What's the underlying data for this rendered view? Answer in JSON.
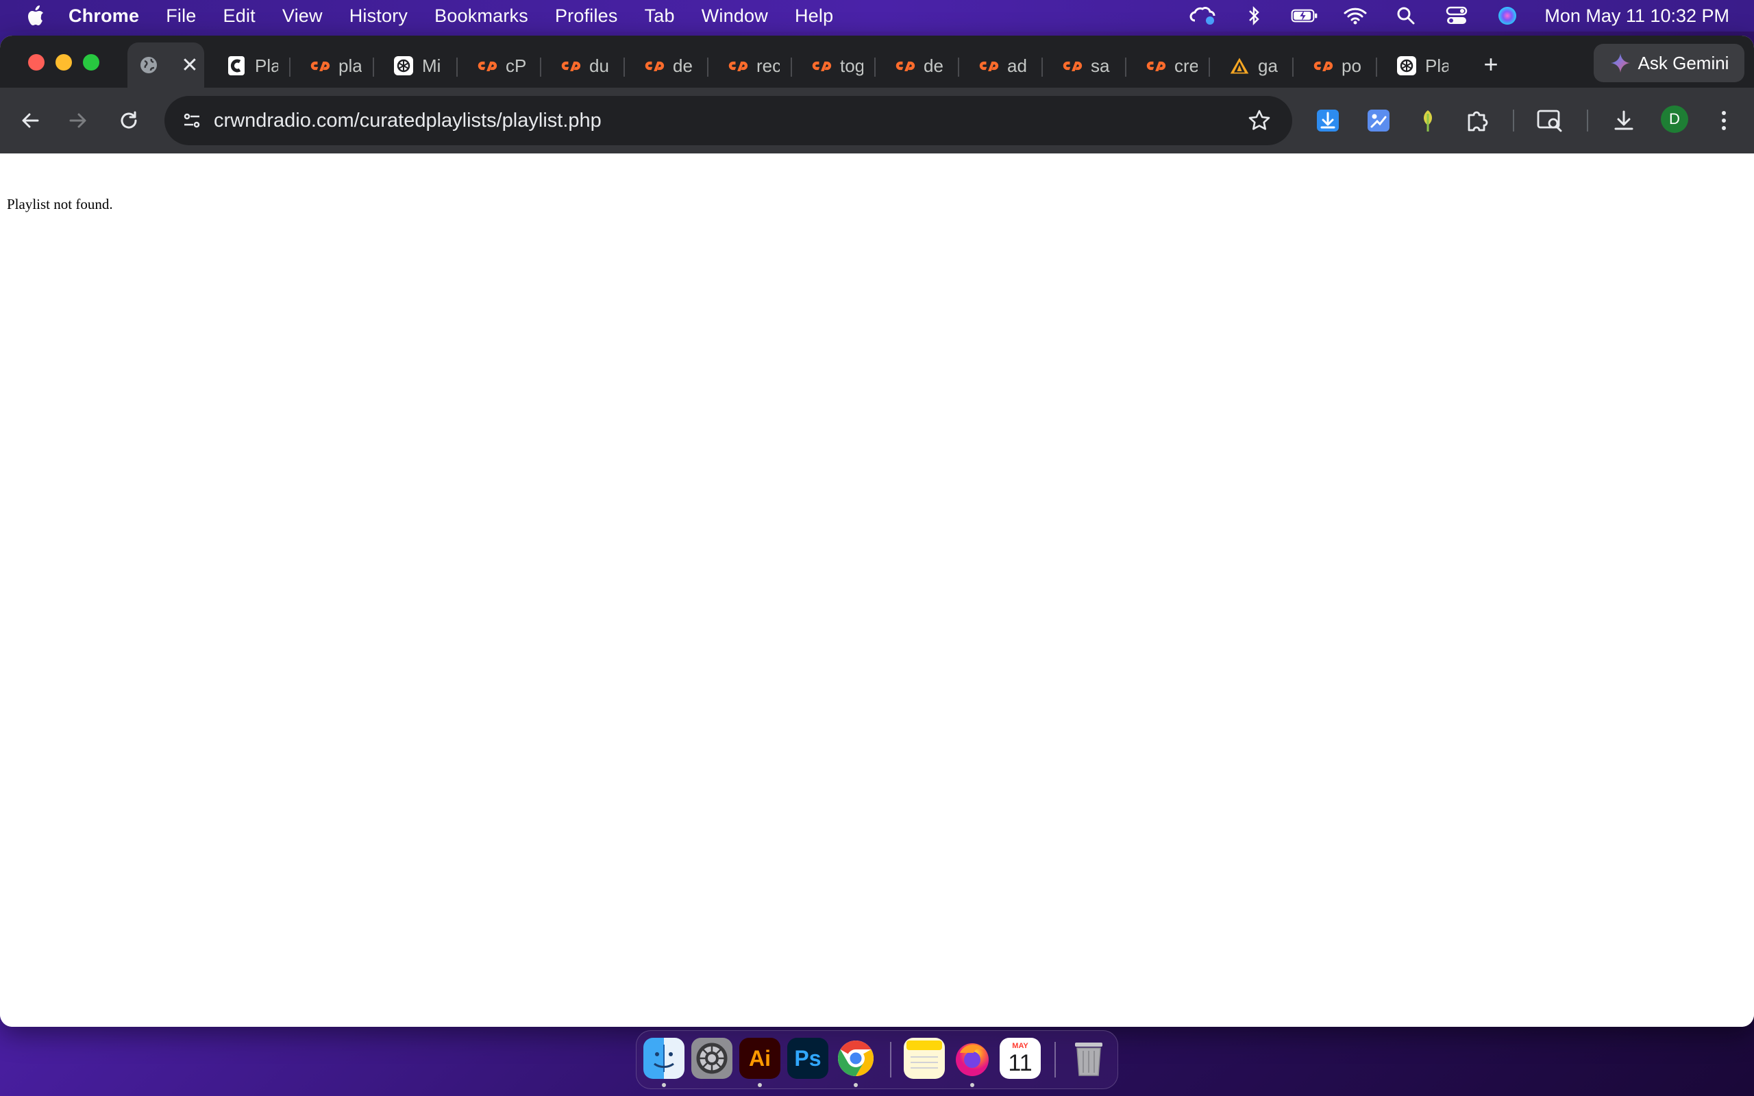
{
  "menubar": {
    "app_name": "Chrome",
    "items": [
      "File",
      "Edit",
      "View",
      "History",
      "Bookmarks",
      "Profiles",
      "Tab",
      "Window",
      "Help"
    ],
    "status_icons": [
      "creative-cloud-icon",
      "bluetooth-icon",
      "battery-charging-icon",
      "wifi-icon",
      "spotlight-search-icon",
      "control-center-icon",
      "siri-icon"
    ],
    "clock": "Mon May 11  10:32 PM"
  },
  "tabs": [
    {
      "title": "",
      "icon": "globe-icon",
      "active": true
    },
    {
      "title": "Pla",
      "icon": "c-logo-icon"
    },
    {
      "title": "pla",
      "icon": "cpanel-icon"
    },
    {
      "title": "Mi",
      "icon": "openai-icon"
    },
    {
      "title": "cP",
      "icon": "cpanel-icon"
    },
    {
      "title": "du",
      "icon": "cpanel-icon"
    },
    {
      "title": "de",
      "icon": "cpanel-icon"
    },
    {
      "title": "rec",
      "icon": "cpanel-icon"
    },
    {
      "title": "tog",
      "icon": "cpanel-icon"
    },
    {
      "title": "de",
      "icon": "cpanel-icon"
    },
    {
      "title": "ad",
      "icon": "cpanel-icon"
    },
    {
      "title": "sa",
      "icon": "cpanel-icon"
    },
    {
      "title": "cre",
      "icon": "cpanel-icon"
    },
    {
      "title": "ga",
      "icon": "pyramid-logo-icon"
    },
    {
      "title": "po",
      "icon": "cpanel-icon"
    },
    {
      "title": "Pla",
      "icon": "openai-icon"
    }
  ],
  "new_tab_label": "+",
  "gemini": {
    "label": "Ask Gemini"
  },
  "address_bar": {
    "url": "crwndradio.com/curatedplaylists/playlist.php"
  },
  "profile": {
    "initial": "D"
  },
  "page": {
    "message": "Playlist not found."
  },
  "dock": {
    "apps": [
      "finder-icon",
      "system-settings-icon",
      "illustrator-icon",
      "photoshop-icon",
      "chrome-icon",
      "notes-icon",
      "firefox-icon",
      "calendar-icon",
      "trash-icon"
    ],
    "illustrator_label": "Ai",
    "photoshop_label": "Ps",
    "calendar_month": "MAY",
    "calendar_day": "11"
  },
  "colors": {
    "accent_gemini": "#4285f4",
    "cpanel_orange": "#ff6c2c",
    "avatar_green": "#1e7e34"
  }
}
